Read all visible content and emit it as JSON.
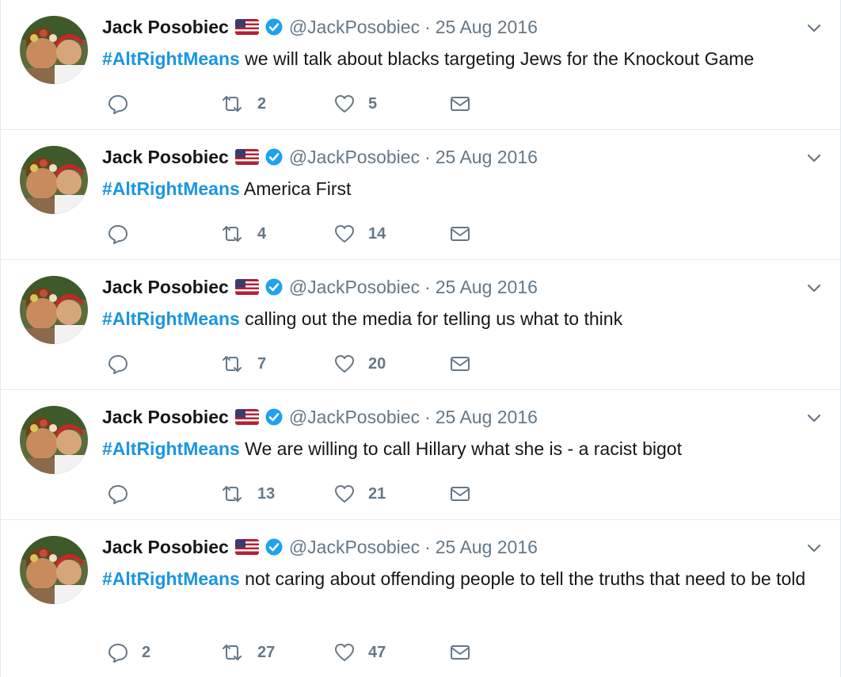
{
  "colors": {
    "accent": "#1b95e0",
    "muted": "#657786",
    "text": "#14171a",
    "divider": "#e6ecf0"
  },
  "icons": [
    "reply-icon",
    "retweet-icon",
    "like-icon",
    "message-icon",
    "verified-icon",
    "flag-icon",
    "caret-down-icon"
  ],
  "tweets": [
    {
      "name": "Jack Posobiec",
      "handle": "@JackPosobiec",
      "dot": "·",
      "date": "25 Aug 2016",
      "hashtag": "#AltRightMeans",
      "text": " we will talk about blacks targeting Jews for the Knockout Game",
      "replies": "",
      "retweets": "2",
      "likes": "5"
    },
    {
      "name": "Jack Posobiec",
      "handle": "@JackPosobiec",
      "dot": "·",
      "date": "25 Aug 2016",
      "hashtag": "#AltRightMeans",
      "text": " America First",
      "replies": "",
      "retweets": "4",
      "likes": "14"
    },
    {
      "name": "Jack Posobiec",
      "handle": "@JackPosobiec",
      "dot": "·",
      "date": "25 Aug 2016",
      "hashtag": "#AltRightMeans",
      "text": " calling out the media for telling us what to think",
      "replies": "",
      "retweets": "7",
      "likes": "20"
    },
    {
      "name": "Jack Posobiec",
      "handle": "@JackPosobiec",
      "dot": "·",
      "date": "25 Aug 2016",
      "hashtag": "#AltRightMeans",
      "text": " We are willing to call Hillary what she is - a racist bigot",
      "replies": "",
      "retweets": "13",
      "likes": "21"
    },
    {
      "name": "Jack Posobiec",
      "handle": "@JackPosobiec",
      "dot": "·",
      "date": "25 Aug 2016",
      "hashtag": "#AltRightMeans",
      "text": " not caring about offending people to tell the truths that need to be told",
      "replies": "2",
      "retweets": "27",
      "likes": "47"
    }
  ]
}
